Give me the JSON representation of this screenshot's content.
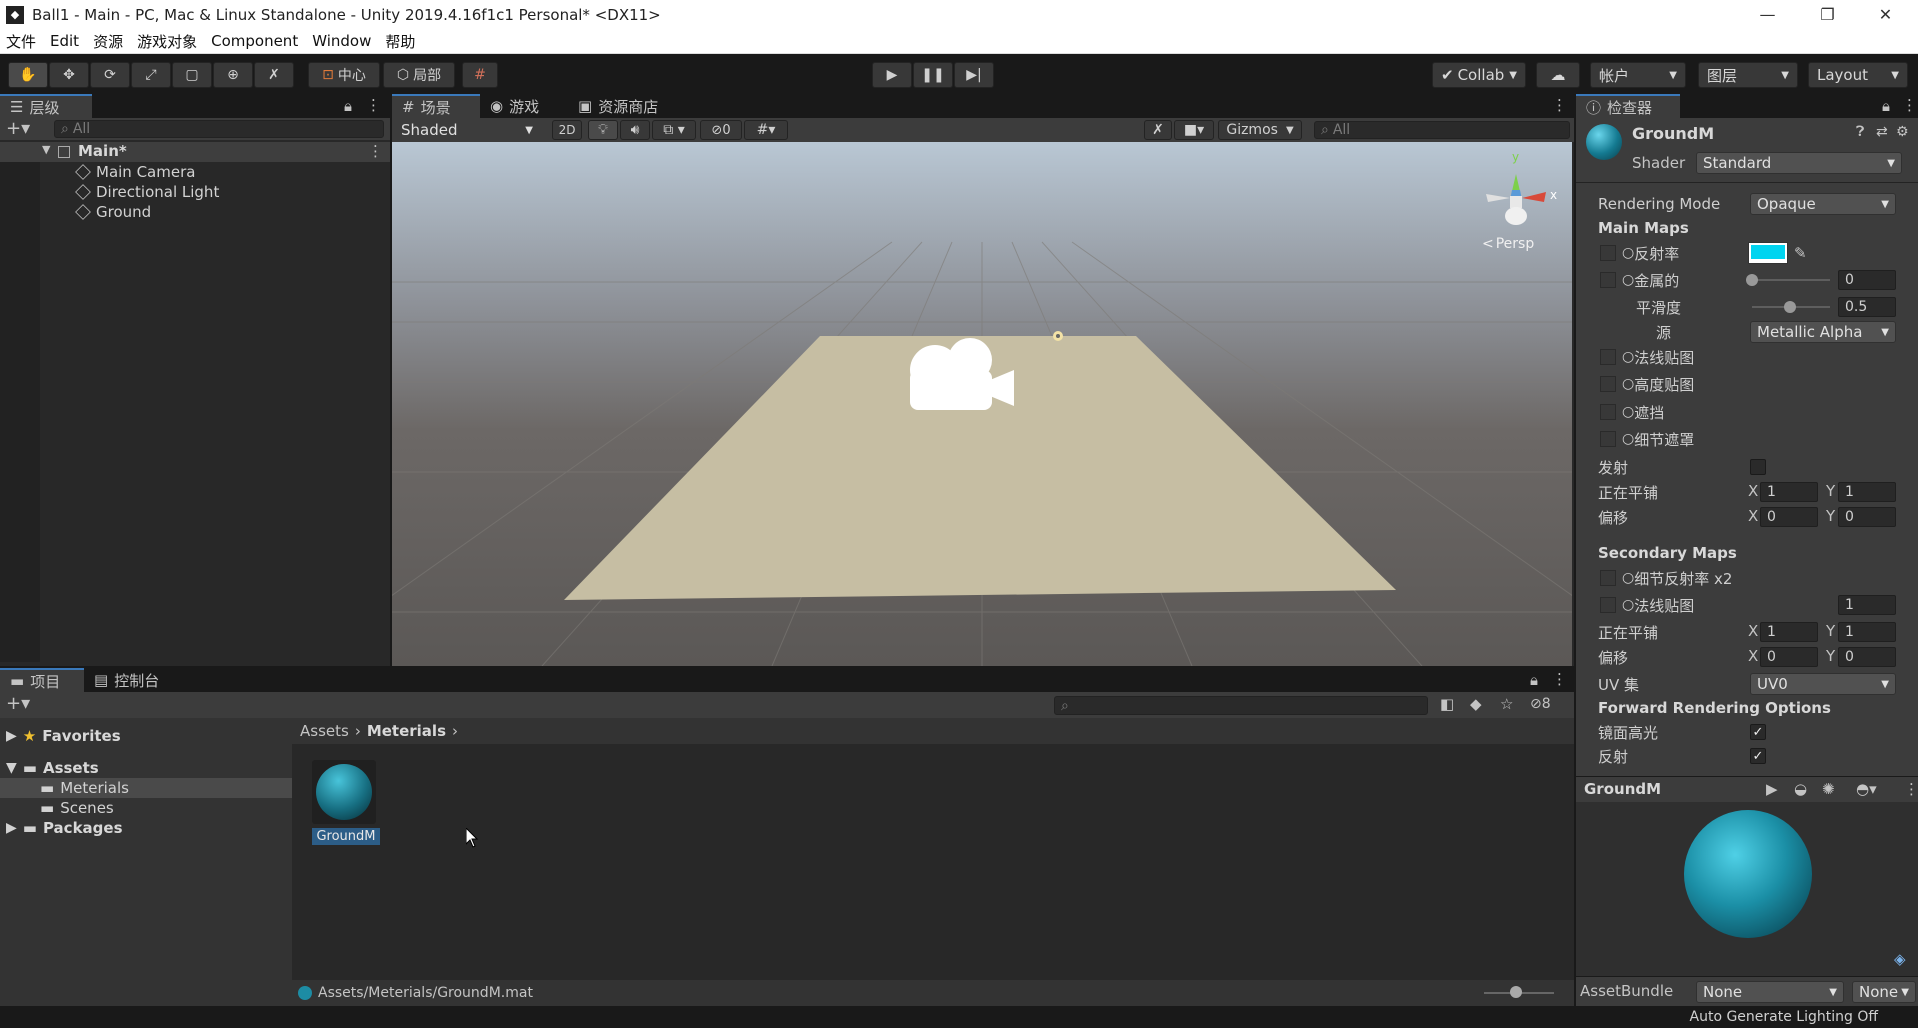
{
  "window": {
    "title": "Ball1 - Main - PC, Mac & Linux Standalone - Unity 2019.4.16f1c1 Personal* <DX11>",
    "minimize": "—",
    "maximize": "❐",
    "close": "✕"
  },
  "menu": [
    "文件",
    "Edit",
    "资源",
    "游戏对象",
    "Component",
    "Window",
    "帮助"
  ],
  "toolbar": {
    "pivot": "中心",
    "local": "局部",
    "collab": "Collab",
    "account": "帐户",
    "layers": "图层",
    "layout": "Layout"
  },
  "hierarchy": {
    "tab": "层级",
    "search_placeholder": "All",
    "scene": "Main*",
    "items": [
      "Main Camera",
      "Directional Light",
      "Ground"
    ]
  },
  "scene_view": {
    "tabs": [
      "场景",
      "游戏",
      "资源商店"
    ],
    "shading": "Shaded",
    "mode_2d": "2D",
    "hidden_count": "0",
    "gizmos": "Gizmos",
    "search_placeholder": "All",
    "persp": "Persp",
    "axis_y": "y",
    "axis_x": "x"
  },
  "project": {
    "tabs": [
      "项目",
      "控制台"
    ],
    "favorites": "Favorites",
    "assets": "Assets",
    "materials": "Meterials",
    "scenes": "Scenes",
    "packages": "Packages",
    "breadcrumb": [
      "Assets",
      "Meterials"
    ],
    "asset_name": "GroundM",
    "hidden_count": "8",
    "status_path": "Assets/Meterials/GroundM.mat"
  },
  "inspector": {
    "tab": "检查器",
    "name": "GroundM",
    "shader_label": "Shader",
    "shader_value": "Standard",
    "rendering_mode_label": "Rendering Mode",
    "rendering_mode_value": "Opaque",
    "main_maps": "Main Maps",
    "albedo": "反射率",
    "albedo_color": "#00d4f0",
    "metallic": "金属的",
    "metallic_value": "0",
    "smoothness": "平滑度",
    "smoothness_value": "0.5",
    "source": "源",
    "source_value": "Metallic Alpha",
    "normal_map": "法线贴图",
    "height_map": "高度贴图",
    "occlusion": "遮挡",
    "detail_mask": "细节遮罩",
    "emission": "发射",
    "tiling": "正在平铺",
    "offset": "偏移",
    "x": "X",
    "y": "Y",
    "tiling_x": "1",
    "tiling_y": "1",
    "offset_x": "0",
    "offset_y": "0",
    "secondary_maps": "Secondary Maps",
    "detail_albedo": "细节反射率 x2",
    "normal_map2": "法线贴图",
    "normal_map2_value": "1",
    "tiling2_x": "1",
    "tiling2_y": "1",
    "offset2_x": "0",
    "offset2_y": "0",
    "uv_set_label": "UV 集",
    "uv_set_value": "UV0",
    "forward_options": "Forward Rendering Options",
    "specular": "镜面高光",
    "reflections": "反射",
    "preview_name": "GroundM",
    "assetbundle_label": "AssetBundle",
    "assetbundle_value": "None",
    "assetbundle_variant": "None"
  },
  "status_bar": "Auto Generate Lighting Off",
  "colors": {
    "accent": "#3a79bb",
    "sphere": "#1b8fa6"
  }
}
